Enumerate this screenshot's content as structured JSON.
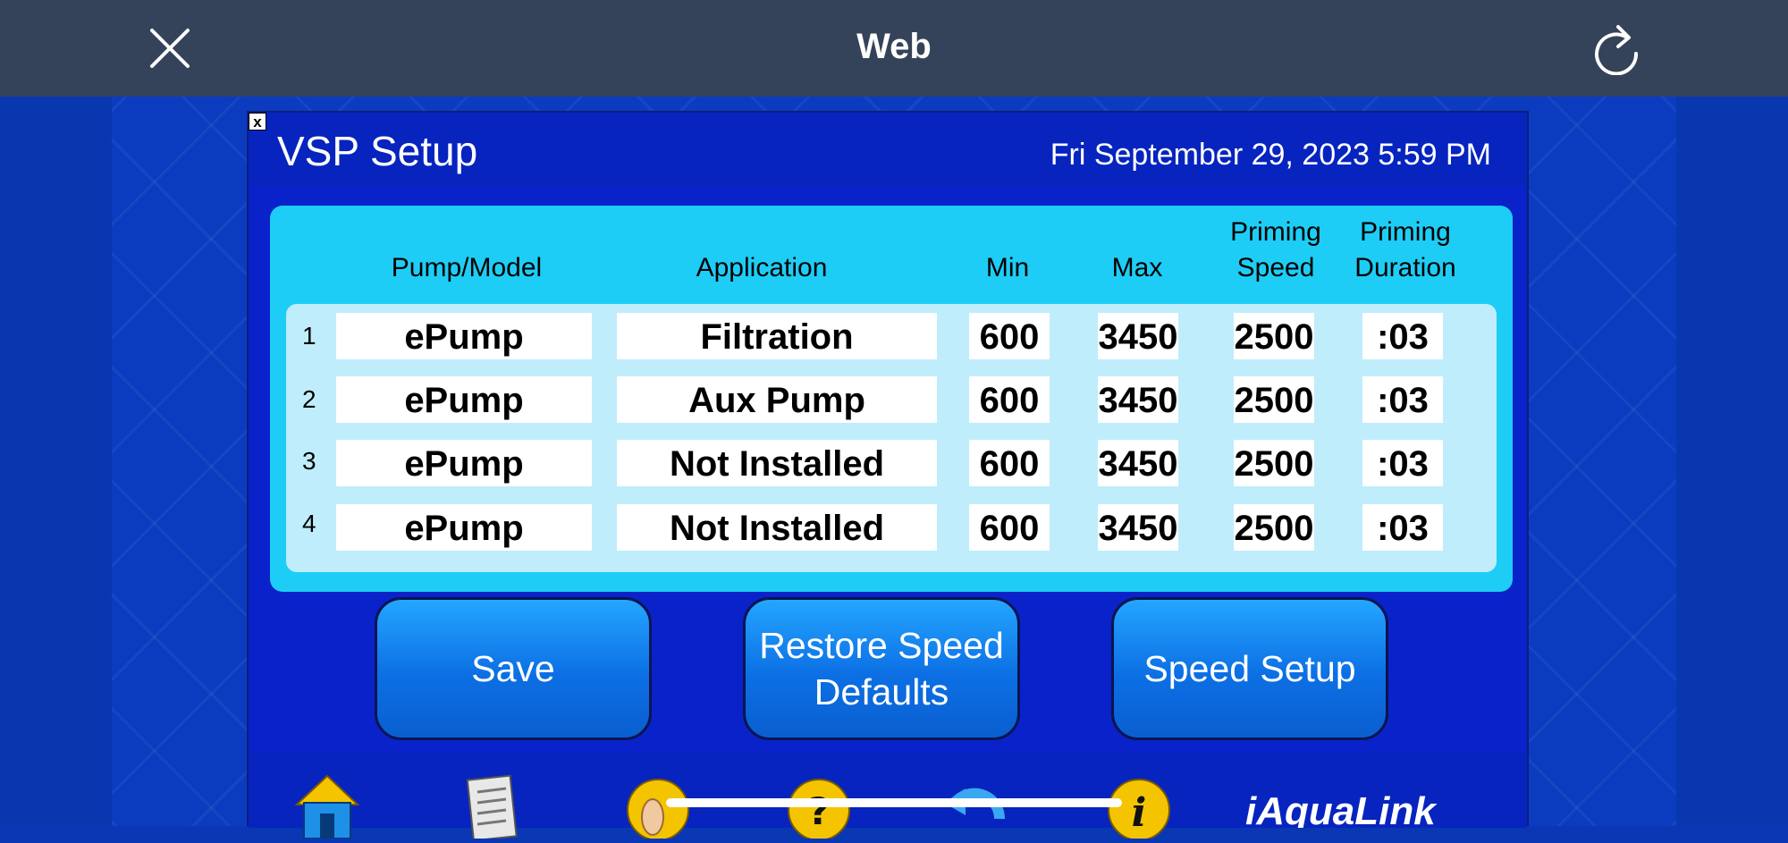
{
  "browser": {
    "title": "Web"
  },
  "panel": {
    "close_glyph": "x",
    "title": "VSP Setup",
    "datetime": "Fri September 29, 2023 5:59 PM"
  },
  "table": {
    "headers": {
      "pump_model": "Pump/Model",
      "application": "Application",
      "min": "Min",
      "max": "Max",
      "priming_speed_1": "Priming",
      "priming_speed_2": "Speed",
      "priming_duration_1": "Priming",
      "priming_duration_2": "Duration"
    },
    "rows": [
      {
        "num": "1",
        "pump": "ePump",
        "application": "Filtration",
        "min": "600",
        "max": "3450",
        "priming_speed": "2500",
        "priming_duration": ":03"
      },
      {
        "num": "2",
        "pump": "ePump",
        "application": "Aux Pump",
        "min": "600",
        "max": "3450",
        "priming_speed": "2500",
        "priming_duration": ":03"
      },
      {
        "num": "3",
        "pump": "ePump",
        "application": "Not Installed",
        "min": "600",
        "max": "3450",
        "priming_speed": "2500",
        "priming_duration": ":03"
      },
      {
        "num": "4",
        "pump": "ePump",
        "application": "Not Installed",
        "min": "600",
        "max": "3450",
        "priming_speed": "2500",
        "priming_duration": ":03"
      }
    ]
  },
  "buttons": {
    "save": "Save",
    "restore_1": "Restore Speed",
    "restore_2": "Defaults",
    "speed_setup": "Speed Setup"
  },
  "bottom_icons": [
    "home-icon",
    "notes-icon",
    "touch-icon",
    "help-icon",
    "back-icon",
    "info-icon"
  ],
  "brand": {
    "logo_text": "iAquaLink"
  },
  "colors": {
    "topbar": "#34435a",
    "panel": "#0a22c9",
    "table_bg": "#1ecdf6",
    "rows_bg": "#bfedfb",
    "button": "#1a8cf5"
  }
}
